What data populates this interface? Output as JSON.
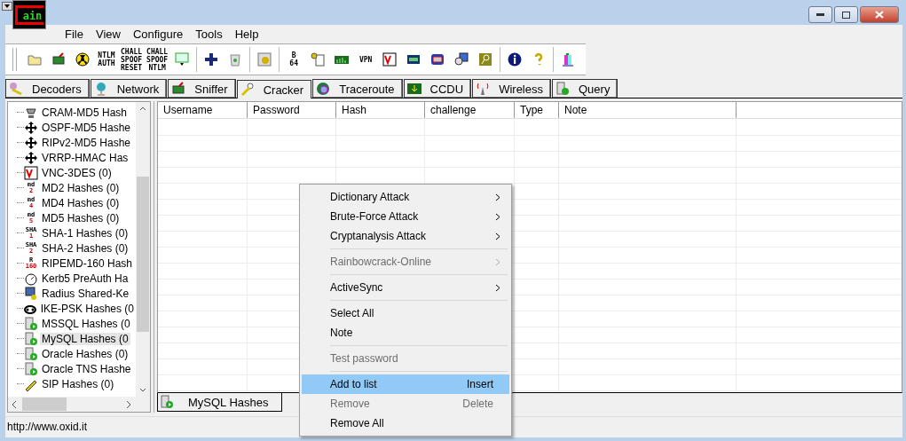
{
  "window": {
    "logo": "ain"
  },
  "menu": [
    "File",
    "View",
    "Configure",
    "Tools",
    "Help"
  ],
  "toolbar": [
    [
      {
        "kind": "glyph"
      },
      {
        "kind": "glyph"
      },
      {
        "kind": "glyph"
      },
      {
        "kind": "text",
        "label": "NTLM AUTH"
      },
      {
        "kind": "text",
        "label": "CHALL SPOOF RESET"
      },
      {
        "kind": "text",
        "label": "CHALL SPOOF NTLM"
      },
      {
        "kind": "glyph"
      }
    ],
    [
      {
        "kind": "glyph"
      },
      {
        "kind": "glyph"
      }
    ],
    [
      {
        "kind": "glyph"
      }
    ],
    [
      {
        "kind": "text",
        "label": "B 64"
      },
      {
        "kind": "glyph"
      },
      {
        "kind": "glyph"
      },
      {
        "kind": "text",
        "label": "VPN"
      },
      {
        "kind": "glyph"
      },
      {
        "kind": "glyph"
      },
      {
        "kind": "glyph"
      },
      {
        "kind": "glyph"
      },
      {
        "kind": "glyph"
      }
    ],
    [
      {
        "kind": "glyph"
      },
      {
        "kind": "glyph"
      }
    ],
    [
      {
        "kind": "glyph"
      }
    ]
  ],
  "tabs": [
    {
      "label": "Decoders",
      "selected": false
    },
    {
      "label": "Network",
      "selected": false
    },
    {
      "label": "Sniffer",
      "selected": false
    },
    {
      "label": "Cracker",
      "selected": true
    },
    {
      "label": "Traceroute",
      "selected": false
    },
    {
      "label": "CCDU",
      "selected": false
    },
    {
      "label": "Wireless",
      "selected": false
    },
    {
      "label": "Query",
      "selected": false
    }
  ],
  "tree": [
    {
      "label": "CRAM-MD5 Hash",
      "selected": false
    },
    {
      "label": "OSPF-MD5 Hashe",
      "selected": false
    },
    {
      "label": "RIPv2-MD5 Hashe",
      "selected": false
    },
    {
      "label": "VRRP-HMAC Has",
      "selected": false
    },
    {
      "label": "VNC-3DES (0)",
      "selected": false
    },
    {
      "label": "MD2 Hashes (0)",
      "badge": "md",
      "sub": "2",
      "selected": false
    },
    {
      "label": "MD4 Hashes (0)",
      "badge": "md",
      "sub": "4",
      "selected": false
    },
    {
      "label": "MD5 Hashes (0)",
      "badge": "md",
      "sub": "5",
      "selected": false
    },
    {
      "label": "SHA-1 Hashes (0)",
      "badge": "SHA",
      "sub": "1",
      "selected": false
    },
    {
      "label": "SHA-2 Hashes (0)",
      "badge": "SHA",
      "sub": "2",
      "selected": false
    },
    {
      "label": "RIPEMD-160 Hash",
      "badge": "R",
      "sub": "160",
      "selected": false
    },
    {
      "label": "Kerb5 PreAuth Ha",
      "selected": false
    },
    {
      "label": "Radius Shared-Ke",
      "selected": false
    },
    {
      "label": "IKE-PSK Hashes (0",
      "selected": false
    },
    {
      "label": "MSSQL Hashes (0",
      "selected": false
    },
    {
      "label": "MySQL Hashes (0",
      "selected": true
    },
    {
      "label": "Oracle Hashes (0)",
      "selected": false
    },
    {
      "label": "Oracle TNS Hashe",
      "selected": false
    },
    {
      "label": "SIP Hashes (0)",
      "selected": false
    }
  ],
  "table": {
    "columns": [
      "Username",
      "Password",
      "Hash",
      "challenge",
      "Type",
      "Note"
    ]
  },
  "bottom_tab": {
    "label": "MySQL Hashes"
  },
  "context_menu": [
    {
      "kind": "item",
      "label": "Dictionary Attack",
      "submenu": true,
      "disabled": false,
      "selected": false
    },
    {
      "kind": "item",
      "label": "Brute-Force Attack",
      "submenu": true,
      "disabled": false,
      "selected": false
    },
    {
      "kind": "item",
      "label": "Cryptanalysis Attack",
      "submenu": true,
      "disabled": false,
      "selected": false
    },
    {
      "kind": "separator"
    },
    {
      "kind": "item",
      "label": "Rainbowcrack-Online",
      "submenu": true,
      "disabled": true,
      "selected": false
    },
    {
      "kind": "separator"
    },
    {
      "kind": "item",
      "label": "ActiveSync",
      "submenu": true,
      "disabled": false,
      "selected": false
    },
    {
      "kind": "separator"
    },
    {
      "kind": "item",
      "label": "Select All",
      "disabled": false,
      "selected": false
    },
    {
      "kind": "item",
      "label": "Note",
      "disabled": false,
      "selected": false
    },
    {
      "kind": "separator"
    },
    {
      "kind": "item",
      "label": "Test password",
      "disabled": true,
      "selected": false
    },
    {
      "kind": "separator"
    },
    {
      "kind": "item",
      "label": "Add to list",
      "shortcut": "Insert",
      "disabled": false,
      "selected": true
    },
    {
      "kind": "item",
      "label": "Remove",
      "shortcut": "Delete",
      "disabled": true,
      "selected": false
    },
    {
      "kind": "item",
      "label": "Remove All",
      "disabled": false,
      "selected": false
    }
  ],
  "status_bar": {
    "text": "http://www.oxid.it"
  }
}
